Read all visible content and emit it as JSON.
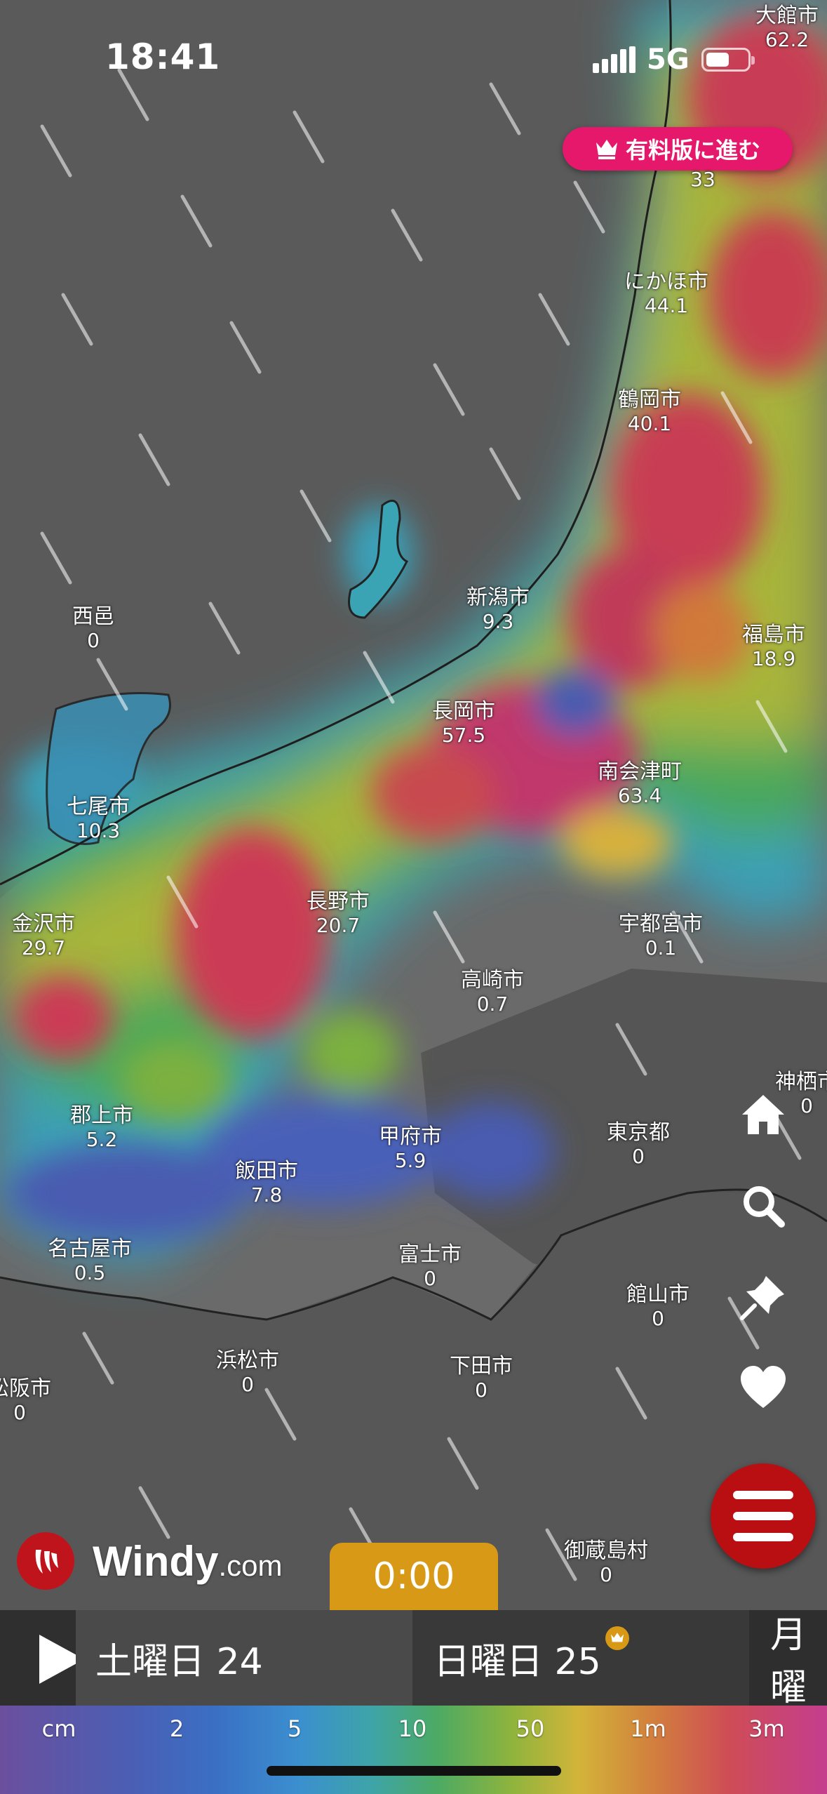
{
  "status_bar": {
    "time": "18:41",
    "network": "5G"
  },
  "premium_button": {
    "label": "有料版に進む"
  },
  "cities": [
    {
      "name": "大館市",
      "value": "62.2"
    },
    {
      "name": "",
      "value": "33"
    },
    {
      "name": "にかほ市",
      "value": "44.1"
    },
    {
      "name": "鶴岡市",
      "value": "40.1"
    },
    {
      "name": "新潟市",
      "value": "9.3"
    },
    {
      "name": "福島市",
      "value": "18.9"
    },
    {
      "name": "西邑",
      "value": "0"
    },
    {
      "name": "長岡市",
      "value": "57.5"
    },
    {
      "name": "南会津町",
      "value": "63.4"
    },
    {
      "name": "七尾市",
      "value": "10.3"
    },
    {
      "name": "長野市",
      "value": "20.7"
    },
    {
      "name": "金沢市",
      "value": "29.7"
    },
    {
      "name": "宇都宮市",
      "value": "0.1"
    },
    {
      "name": "高崎市",
      "value": "0.7"
    },
    {
      "name": "神栖市",
      "value": "0"
    },
    {
      "name": "郡上市",
      "value": "5.2"
    },
    {
      "name": "甲府市",
      "value": "5.9"
    },
    {
      "name": "東京都",
      "value": "0"
    },
    {
      "name": "飯田市",
      "value": "7.8"
    },
    {
      "name": "名古屋市",
      "value": "0.5"
    },
    {
      "name": "富士市",
      "value": "0"
    },
    {
      "name": "館山市",
      "value": "0"
    },
    {
      "name": "浜松市",
      "value": "0"
    },
    {
      "name": "下田市",
      "value": "0"
    },
    {
      "name": "松阪市",
      "value": "0"
    },
    {
      "name": "御蔵島村",
      "value": "0"
    }
  ],
  "side_icons": [
    "home-icon",
    "search-icon",
    "pin-icon",
    "heart-icon"
  ],
  "logo": {
    "name": "Windy",
    "suffix": ".com"
  },
  "timeline": {
    "current_time": "0:00",
    "days": [
      "土曜日 24",
      "日曜日 25",
      "月曜"
    ]
  },
  "legend": {
    "unit": "cm",
    "labels": [
      "cm",
      "2",
      "5",
      "10",
      "50",
      "1m",
      "3m"
    ]
  },
  "colors": {
    "premium": "#e5186c",
    "menu": "#b90f12",
    "time_accent": "#d89916"
  }
}
